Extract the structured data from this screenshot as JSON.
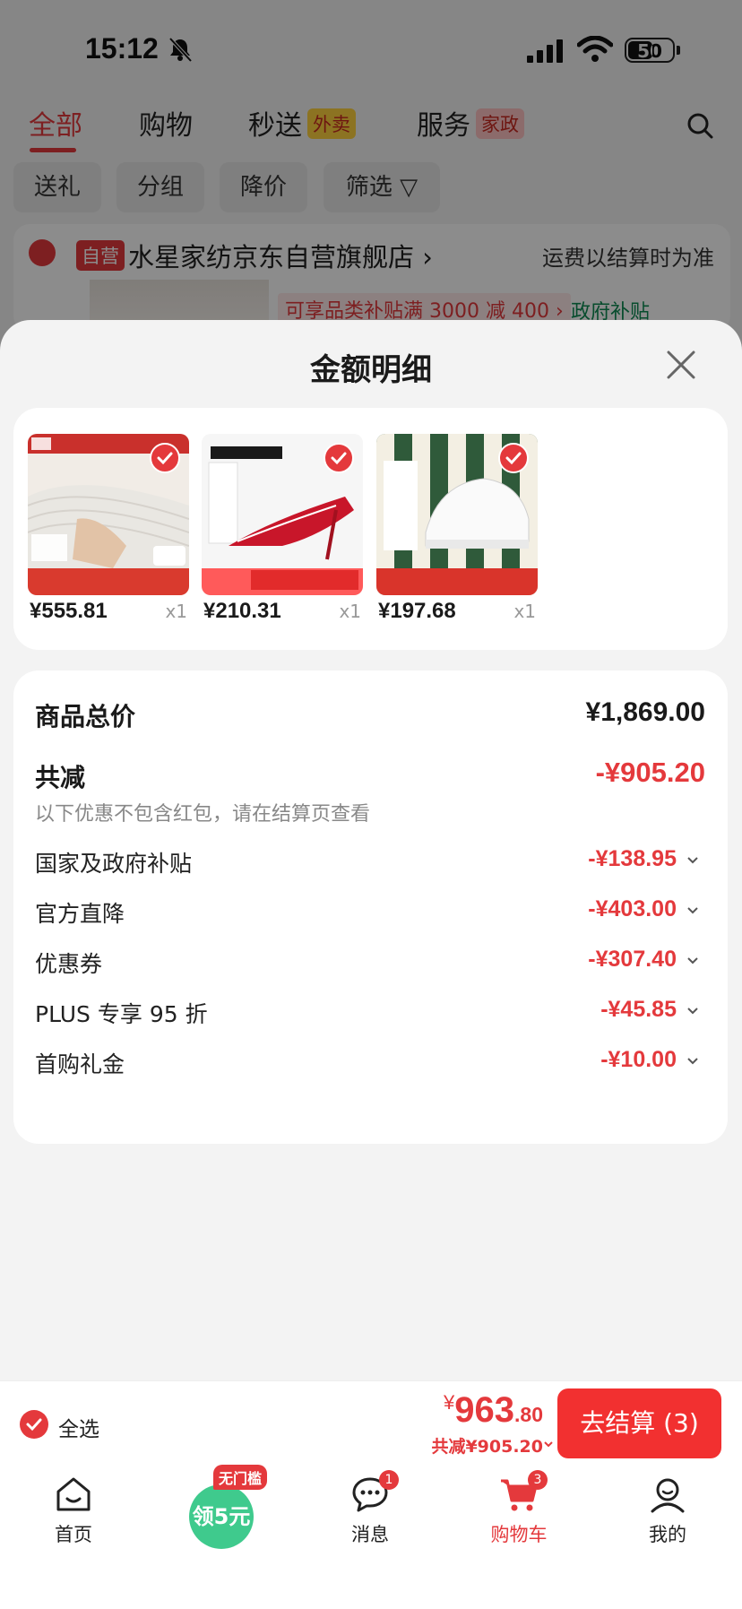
{
  "status_bar": {
    "time": "15:12",
    "battery": "50"
  },
  "top_tabs": [
    {
      "label": "全部",
      "tag": ""
    },
    {
      "label": "购物",
      "tag": ""
    },
    {
      "label": "秒送",
      "tag": "外卖"
    },
    {
      "label": "服务",
      "tag": "家政"
    }
  ],
  "filters": [
    "送礼",
    "分组",
    "降价",
    "筛选"
  ],
  "shop": {
    "self_tag": "自营",
    "name": "水星家纺京东自营旗舰店",
    "note": "运费以结算时为准",
    "promo": "可享品类补贴满 3000 减 400 ›",
    "gov_label": "政府补贴"
  },
  "sheet": {
    "title": "金额明细",
    "products": [
      {
        "price": "¥555.81",
        "qty": "x1"
      },
      {
        "price": "¥210.31",
        "qty": "x1"
      },
      {
        "price": "¥197.68",
        "qty": "x1"
      }
    ],
    "total_label": "商品总价",
    "total_value": "¥1,869.00",
    "reduce_label": "共减",
    "reduce_value": "-¥905.20",
    "reduce_note": "以下优惠不包含红包，请在结算页查看",
    "discounts": [
      {
        "label": "国家及政府补贴",
        "value": "-¥138.95"
      },
      {
        "label": "官方直降",
        "value": "-¥403.00"
      },
      {
        "label": "优惠券",
        "value": "-¥307.40"
      },
      {
        "label": "PLUS 专享 95 折",
        "value": "-¥45.85"
      },
      {
        "label": "首购礼金",
        "value": "-¥10.00"
      }
    ]
  },
  "checkout": {
    "select_all": "全选",
    "currency": "¥",
    "total_int": "963",
    "total_dec": ".80",
    "total_sub": "共减¥905.20",
    "button": "去结算 (3)"
  },
  "nav": {
    "items": [
      {
        "label": "首页"
      },
      {
        "label": "领5元",
        "badge": "无门槛"
      },
      {
        "label": "消息",
        "badge": "1"
      },
      {
        "label": "购物车",
        "badge": "3"
      },
      {
        "label": "我的"
      }
    ]
  },
  "colors": {
    "accent": "#e4393c",
    "checkout_button": "#f23030",
    "coupon_green": "#3fca8d"
  }
}
